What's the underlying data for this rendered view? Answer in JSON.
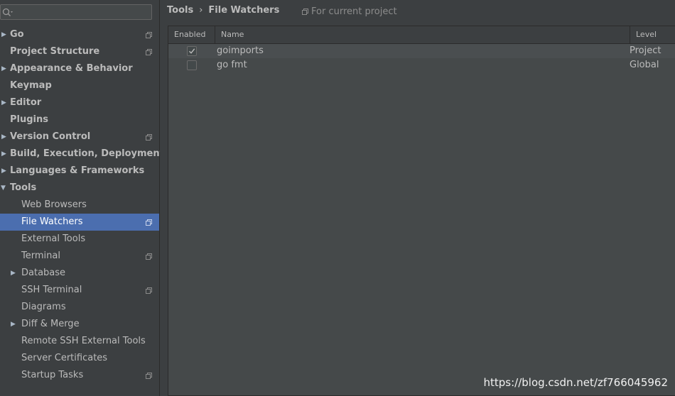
{
  "search": {
    "placeholder": "",
    "value": ""
  },
  "sidebar": {
    "items": [
      {
        "label": "Go",
        "arrow": "▶",
        "project": true
      },
      {
        "label": "Project Structure",
        "arrow": "",
        "project": true
      },
      {
        "label": "Appearance & Behavior",
        "arrow": "▶",
        "project": false
      },
      {
        "label": "Keymap",
        "arrow": "",
        "project": false
      },
      {
        "label": "Editor",
        "arrow": "▶",
        "project": false
      },
      {
        "label": "Plugins",
        "arrow": "",
        "project": false
      },
      {
        "label": "Version Control",
        "arrow": "▶",
        "project": true
      },
      {
        "label": "Build, Execution, Deployment",
        "arrow": "▶",
        "project": false
      },
      {
        "label": "Languages & Frameworks",
        "arrow": "▶",
        "project": false
      },
      {
        "label": "Tools",
        "arrow": "▼",
        "project": false
      },
      {
        "label": "Web Browsers",
        "arrow": "",
        "project": false
      },
      {
        "label": "File Watchers",
        "arrow": "",
        "project": true
      },
      {
        "label": "External Tools",
        "arrow": "",
        "project": false
      },
      {
        "label": "Terminal",
        "arrow": "",
        "project": true
      },
      {
        "label": "Database",
        "arrow": "▶",
        "project": false
      },
      {
        "label": "SSH Terminal",
        "arrow": "",
        "project": true
      },
      {
        "label": "Diagrams",
        "arrow": "",
        "project": false
      },
      {
        "label": "Diff & Merge",
        "arrow": "▶",
        "project": false
      },
      {
        "label": "Remote SSH External Tools",
        "arrow": "",
        "project": false
      },
      {
        "label": "Server Certificates",
        "arrow": "",
        "project": false
      },
      {
        "label": "Startup Tasks",
        "arrow": "",
        "project": true
      }
    ]
  },
  "breadcrumb": {
    "parent": "Tools",
    "separator": "›",
    "current": "File Watchers"
  },
  "scope": {
    "label": "For current project"
  },
  "table": {
    "columns": {
      "enabled": "Enabled",
      "name": "Name",
      "level": "Level"
    },
    "rows": [
      {
        "enabled": true,
        "name": "goimports",
        "level": "Project"
      },
      {
        "enabled": false,
        "name": "go fmt",
        "level": "Global"
      }
    ]
  },
  "watermark": "https://blog.csdn.net/zf766045962",
  "colors": {
    "selection": "#4b6eaf",
    "background": "#3c3f41",
    "table_bg": "#45494a"
  }
}
